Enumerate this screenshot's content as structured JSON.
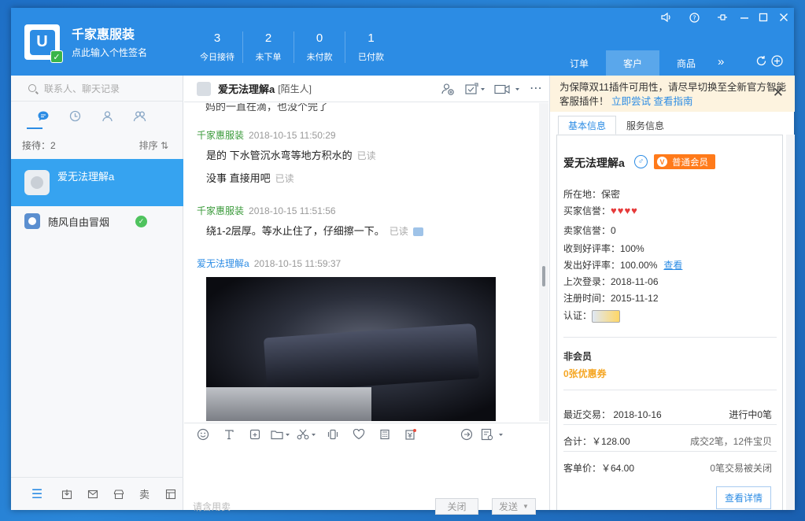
{
  "header": {
    "store_name": "千家惠服装",
    "signature": "点此输入个性签名",
    "stats": [
      {
        "value": "3",
        "label": "今日接待"
      },
      {
        "value": "2",
        "label": "未下单"
      },
      {
        "value": "0",
        "label": "未付款"
      },
      {
        "value": "1",
        "label": "已付款"
      }
    ],
    "tabs": [
      "订单",
      "客户",
      "商品"
    ],
    "active_tab": "客户",
    "logo_glyph": "U"
  },
  "sidebar": {
    "search_placeholder": "联系人、聊天记录",
    "queue_label": "接待：2",
    "sort_label": "排序 ⇅",
    "contacts": [
      {
        "name": "爱无法理解a",
        "active": true
      },
      {
        "name": "随风自由冒烟",
        "online": true
      }
    ],
    "bottom_glyph": "卖"
  },
  "chat": {
    "title": "爱无法理解a",
    "tag": "[陌生人]",
    "partial_line": "妈的一直在滴，也没个完了",
    "messages": [
      {
        "sender": "千家惠服装",
        "time": "2018-10-15 11:50:29"
      },
      {
        "text": "是的 下水管沉水弯等地方积水的",
        "status": "已读"
      },
      {
        "text": "没事 直接用吧",
        "status": "已读"
      },
      {
        "sender": "千家惠服装",
        "time": "2018-10-15 11:51:56"
      },
      {
        "text": "绕1-2层厚。等水止住了，仔细擦一下。",
        "status": "已读"
      },
      {
        "sender": "爱无法理解a",
        "time": "2018-10-15 11:59:37"
      }
    ],
    "input_hint": "请含用卖",
    "close_label": "关闭",
    "send_label": "发送"
  },
  "notice": {
    "text": "为保障双11插件可用性，请尽早切换至全新官方智能客服插件！",
    "link1": "立即尝试",
    "link2": "查看指南"
  },
  "customer": {
    "tabs": [
      "基本信息",
      "服务信息"
    ],
    "name": "爱无法理解a",
    "gender_glyph": "♂",
    "vip_label": "普通会员",
    "location": "所在地：保密",
    "buyer_credit_label": "买家信誉：",
    "seller_credit": "卖家信誉：0",
    "good_rate_received": "收到好评率：100%",
    "good_rate_given": "发出好评率：100.00%",
    "view_link": "查看",
    "last_login": "上次登录：2018-11-06",
    "registered": "注册时间：2015-11-12",
    "cert_label": "认证：",
    "member_status": "非会员",
    "coupons": "0张优惠券",
    "recent_trade": "最近交易：  2018-10-16",
    "in_progress": "进行中0笔",
    "total": "合计：￥128.00",
    "orders": "成交2笔，12件宝贝",
    "avg_price": "客单价：￥64.00",
    "closed": "0笔交易被关闭",
    "detail_button": "查看详情"
  },
  "colors": {
    "accent": "#2c8ce4",
    "active_contact": "#36a3f0",
    "vip": "#ff7a1a"
  }
}
